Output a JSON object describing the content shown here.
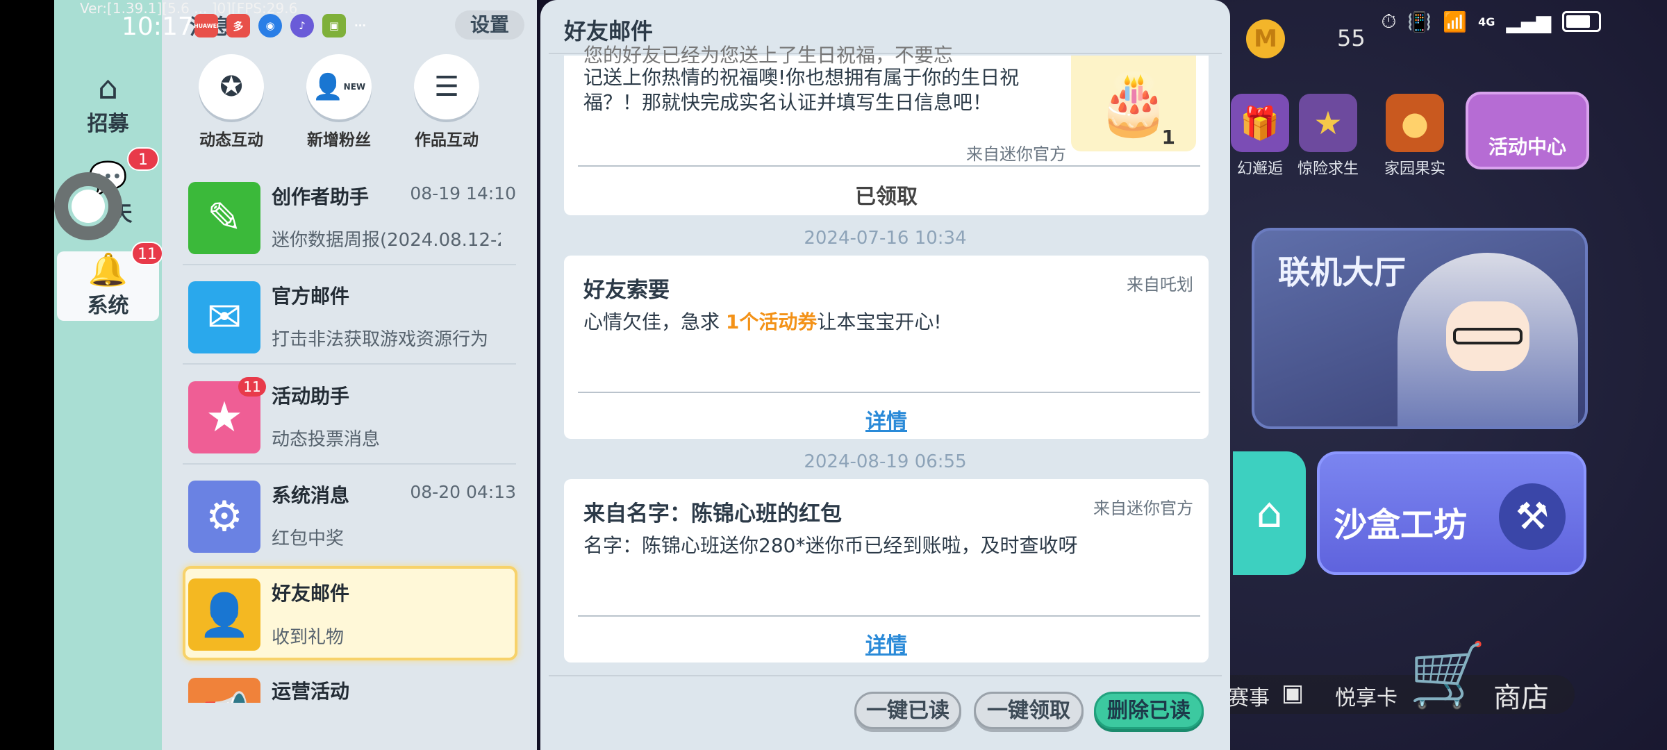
{
  "status_bar": {
    "version_text": "Ver:[1.39.1][5.6 ... ]0][FPS:29.6",
    "time": "10:17",
    "notification_icons": [
      "HUAWEI",
      "多",
      "◉",
      "♪",
      "▣",
      "···"
    ],
    "network_label": "4G"
  },
  "sidebar": {
    "items": [
      {
        "label": "招募",
        "icon": "house-icon"
      },
      {
        "label": "天",
        "icon": "chat-icon",
        "badge": "1"
      },
      {
        "label": "系统",
        "icon": "bell-icon",
        "badge": "11"
      }
    ]
  },
  "middle": {
    "tab_title": "消息",
    "settings_label": "设置",
    "top_buttons": [
      {
        "label": "动态互动",
        "icon": "star-chat-icon"
      },
      {
        "label": "新增粉丝",
        "icon": "new-fan-icon",
        "badge_text": "NEW"
      },
      {
        "label": "作品互动",
        "icon": "list-icon"
      }
    ],
    "conversations": [
      {
        "name": "创作者助手",
        "time": "08-19 14:10",
        "subtitle": "迷你数据周报(2024.08.12-2",
        "icon": "pencil-ruler-icon",
        "color": "#3bb93a"
      },
      {
        "name": "官方邮件",
        "time": "",
        "subtitle": "打击非法获取游戏资源行为",
        "icon": "envelope-icon",
        "color": "#2aa8ec"
      },
      {
        "name": "活动助手",
        "time": "",
        "subtitle": "动态投票消息",
        "icon": "bookmark-star-icon",
        "color": "#ef5e95",
        "badge": "11"
      },
      {
        "name": "系统消息",
        "time": "08-20 04:13",
        "subtitle": "红包中奖",
        "icon": "gear-icon",
        "color": "#6a82e3"
      },
      {
        "name": "好友邮件",
        "time": "",
        "subtitle": "收到礼物",
        "icon": "friend-mail-icon",
        "color": "#f4b822"
      },
      {
        "name": "运营活动",
        "time": "",
        "subtitle": "",
        "icon": "megaphone-icon",
        "color": "#f0823a"
      }
    ]
  },
  "panel": {
    "title": "好友邮件",
    "first_card": {
      "text_line1": "您的好友已经为您送上了生日祝福，不要忘",
      "text_line2": "记送上你热情的祝福噢!你也想拥有属于你的生日祝",
      "text_line3": "福？！那就快完成实名认证并填写生日信息吧！",
      "source": "来自迷你官方",
      "status": "已领取",
      "gift_count": "1"
    },
    "messages": [
      {
        "date": "2024-07-16 10:34",
        "title": "好友索要",
        "source": "来自吒划",
        "body_pre": "心情欠佳，急求 ",
        "body_highlight": "1个活动券",
        "body_post": "让本宝宝开心!",
        "link": "详情"
      },
      {
        "date": "2024-08-19 06:55",
        "title": "来自名字：陈锦心班的红包",
        "source": "来自迷你官方",
        "body_pre": "名字：陈锦心班送你280*迷你币已经到账啦，及时查收呀",
        "body_highlight": "",
        "body_post": "",
        "link": "详情"
      }
    ],
    "footer_buttons": [
      "一键已读",
      "一键领取",
      "删除已读"
    ]
  },
  "background": {
    "coin_count": "55",
    "events": [
      "幻邂逅",
      "惊险求生",
      "家园果实"
    ],
    "event_center": "活动中心",
    "lobby_title": "联机大厅",
    "sandbox_title": "沙盒工坊",
    "bottom_items": [
      "赛事",
      "悦享卡",
      "商店"
    ]
  }
}
